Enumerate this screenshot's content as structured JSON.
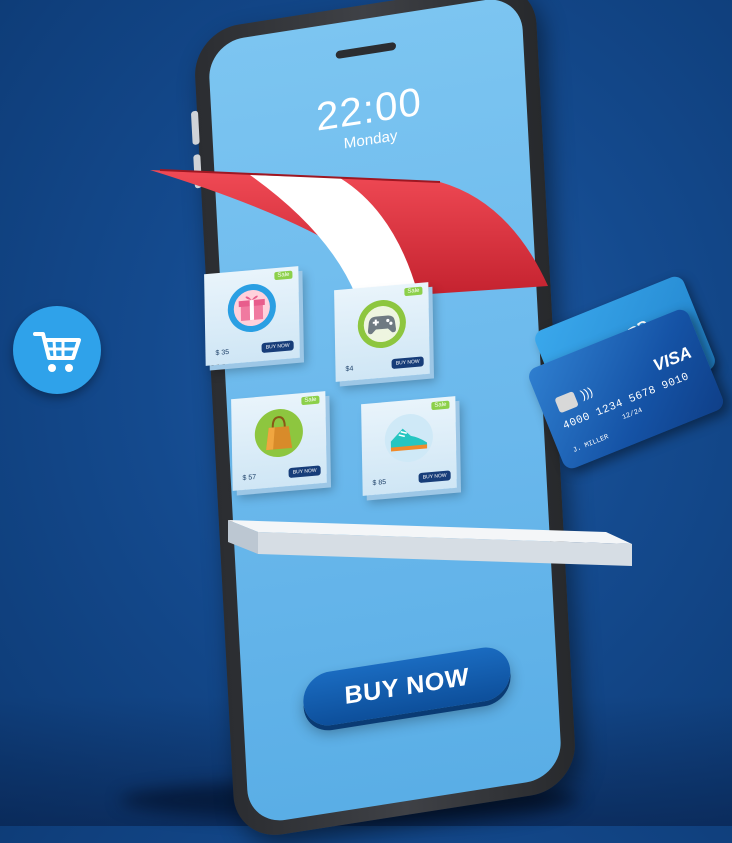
{
  "status": {
    "time": "22:00",
    "day": "Monday"
  },
  "actions": {
    "buy_label": "BUY NOW"
  },
  "products": [
    {
      "icon": "gift-icon",
      "price": "$ 35",
      "cta": "BUY NOW",
      "tag": "Sale"
    },
    {
      "icon": "gamepad-icon",
      "price": "$4",
      "cta": "BUY NOW",
      "tag": "Sale"
    },
    {
      "icon": "shopping-bag-icon",
      "price": "$ 57",
      "cta": "BUY NOW",
      "tag": "Sale"
    },
    {
      "icon": "sneaker-icon",
      "price": "$ 85",
      "cta": "BUY NOW",
      "tag": "Sale"
    }
  ],
  "credit_card_back": {
    "label": "CREDIT CARD"
  },
  "credit_card_front": {
    "number": "4000 1234 5678 9010",
    "expiry": "12/24",
    "holder": "J. MILLER",
    "brand": "VISA"
  },
  "colors": {
    "background": "#144a8e",
    "screen": "#6ab8ec",
    "awning_red": "#e53b47",
    "awning_white": "#ffffff",
    "button": "#0d4f9b",
    "cart_badge": "#2fa2ea",
    "product_tag": "#8cd04a"
  }
}
